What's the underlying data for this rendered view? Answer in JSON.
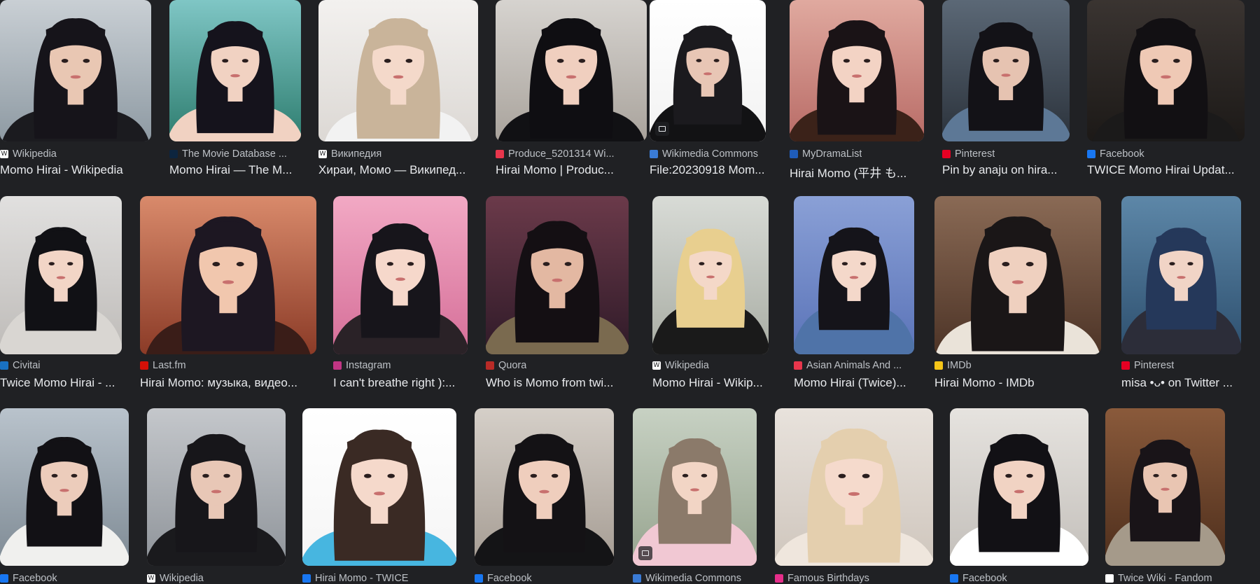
{
  "rows": [
    {
      "items": [
        {
          "source": "Wikipedia",
          "title": "Momo Hirai - Wikipedia",
          "favicon": "W",
          "favicon_color": "#ffffff",
          "favicon_text": "#202124",
          "bg": [
            "#c9cfd4",
            "#8e9aa3"
          ],
          "hair": "#16141a",
          "skin": "#e9c7b3",
          "outfit": "#1b1b1f",
          "icon": "wikipedia-icon"
        },
        {
          "source": "The Movie Database ...",
          "title": "Momo Hirai — The M...",
          "favicon": "",
          "favicon_color": "#0d253f",
          "favicon_text": "#90cea1",
          "bg": [
            "#7fc6c5",
            "#2e7d6f"
          ],
          "hair": "#15131c",
          "skin": "#f1d2c2",
          "outfit": "#f1d2c2",
          "icon": "tmdb-icon"
        },
        {
          "source": "Википедия",
          "title": "Хираи, Момо — Википед...",
          "favicon": "W",
          "favicon_color": "#ffffff",
          "favicon_text": "#202124",
          "bg": [
            "#f3f1ef",
            "#dcd8d4"
          ],
          "hair": "#c9b49a",
          "skin": "#f4d9ca",
          "outfit": "#f2f2f2",
          "icon": "wikipedia-icon"
        },
        {
          "source": "Produce_5201314 Wi...",
          "title": "Hirai Momo | Produc...",
          "favicon": "",
          "favicon_color": "#e8364c",
          "favicon_text": "#ffffff",
          "bg": [
            "#d6d3cf",
            "#a9a39c"
          ],
          "hair": "#0f0e12",
          "skin": "#f0cfbf",
          "outfit": "#111114",
          "icon": "fandom-icon"
        },
        {
          "source": "Wikimedia Commons",
          "title": "File:20230918 Mom...",
          "favicon": "",
          "favicon_color": "#3a7bd5",
          "favicon_text": "#ffffff",
          "bg": [
            "#ffffff",
            "#f2f2f2"
          ],
          "hair": "#1b1a1e",
          "skin": "#e8c6b5",
          "outfit": "#121214",
          "icon": "wikimedia-icon",
          "badge": true
        },
        {
          "source": "MyDramaList",
          "title": "Hirai Momo (平井 も...",
          "favicon": "",
          "favicon_color": "#1f5cb8",
          "favicon_text": "#ffffff",
          "bg": [
            "#e0a99f",
            "#b86b66"
          ],
          "hair": "#1a1316",
          "skin": "#f3d3c4",
          "outfit": "#3b2219",
          "icon": "mydramalist-icon"
        },
        {
          "source": "Pinterest",
          "title": "Pin by anaju on hira...",
          "favicon": "",
          "favicon_color": "#e60023",
          "favicon_text": "#ffffff",
          "bg": [
            "#5b6876",
            "#2b323b"
          ],
          "hair": "#131217",
          "skin": "#e6c3b1",
          "outfit": "#5d7896",
          "icon": "pinterest-icon"
        },
        {
          "source": "Facebook",
          "title": "TWICE Momo Hirai Updat...",
          "favicon": "",
          "favicon_color": "#1877f2",
          "favicon_text": "#ffffff",
          "bg": [
            "#3a3431",
            "#1c1917"
          ],
          "hair": "#121013",
          "skin": "#efc9b5",
          "outfit": "#1b1a1a",
          "icon": "facebook-icon"
        }
      ]
    },
    {
      "items": [
        {
          "source": "Civitai",
          "title": "Twice Momo Hirai - ...",
          "favicon": "",
          "favicon_color": "#1971c2",
          "favicon_text": "#ffffff",
          "bg": [
            "#e1e0df",
            "#bebbb8"
          ],
          "hair": "#111115",
          "skin": "#f2d5c6",
          "outfit": "#d9d6d2",
          "icon": "civitai-icon"
        },
        {
          "source": "Last.fm",
          "title": "Hirai Momo: музыка, видео...",
          "favicon": "",
          "favicon_color": "#d51007",
          "favicon_text": "#ffffff",
          "bg": [
            "#d98a6b",
            "#8b3b27"
          ],
          "hair": "#1d1722",
          "skin": "#f1c7ae",
          "outfit": "#3a1d18",
          "icon": "lastfm-icon"
        },
        {
          "source": "Instagram",
          "title": "I can't breathe right ):...",
          "favicon": "",
          "favicon_color": "#c13584",
          "favicon_text": "#ffffff",
          "bg": [
            "#f2a9c4",
            "#d56e98"
          ],
          "hair": "#17151b",
          "skin": "#f6d8cb",
          "outfit": "#2a2227",
          "icon": "instagram-icon"
        },
        {
          "source": "Quora",
          "title": "Who is Momo from twi...",
          "favicon": "",
          "favicon_color": "#b92b27",
          "favicon_text": "#ffffff",
          "bg": [
            "#6b3a4a",
            "#2f1a28"
          ],
          "hair": "#140f13",
          "skin": "#e3b8a2",
          "outfit": "#7a6a4f",
          "icon": "quora-icon"
        },
        {
          "source": "Wikipedia",
          "title": "Momo Hirai - Wikip...",
          "favicon": "W",
          "favicon_color": "#ffffff",
          "favicon_text": "#202124",
          "bg": [
            "#d8dbd6",
            "#a9ada4"
          ],
          "hair": "#e8cf8f",
          "skin": "#f4d8c8",
          "outfit": "#1a1a1a",
          "icon": "wikipedia-icon"
        },
        {
          "source": "Asian Animals And ...",
          "title": "Momo Hirai (Twice)...",
          "favicon": "",
          "favicon_color": "#e8364c",
          "favicon_text": "#ffffff",
          "bg": [
            "#8aa0d6",
            "#5a73b8"
          ],
          "hair": "#15141a",
          "skin": "#f4d8ca",
          "outfit": "#4f73a8",
          "icon": "fandom-icon"
        },
        {
          "source": "IMDb",
          "title": "Hirai Momo - IMDb",
          "favicon": "",
          "favicon_color": "#f5c518",
          "favicon_text": "#000000",
          "bg": [
            "#8a6a55",
            "#4d3427"
          ],
          "hair": "#1a1617",
          "skin": "#efd0bf",
          "outfit": "#eae3d9",
          "icon": "imdb-icon"
        },
        {
          "source": "Pinterest",
          "title": "misa •ᴗ• on Twitter ...",
          "favicon": "",
          "favicon_color": "#e60023",
          "favicon_text": "#ffffff",
          "bg": [
            "#5d87a8",
            "#2d4f6e"
          ],
          "hair": "#25385a",
          "skin": "#f1d4c6",
          "outfit": "#2c2d39",
          "icon": "pinterest-icon"
        }
      ]
    },
    {
      "items": [
        {
          "source": "Facebook",
          "title": "",
          "favicon": "",
          "favicon_color": "#1877f2",
          "favicon_text": "#ffffff",
          "bg": [
            "#b9c3cc",
            "#7e8a94"
          ],
          "hair": "#121115",
          "skin": "#ecccbb",
          "outfit": "#f0f0ee",
          "icon": "facebook-icon"
        },
        {
          "source": "Wikipedia",
          "title": "",
          "favicon": "W",
          "favicon_color": "#ffffff",
          "favicon_text": "#202124",
          "bg": [
            "#c4c7cb",
            "#8f949a"
          ],
          "hair": "#17161a",
          "skin": "#e8c7b6",
          "outfit": "#1a1a1d",
          "icon": "wikipedia-icon"
        },
        {
          "source": "Hirai Momo - TWICE",
          "title": "",
          "favicon": "",
          "favicon_color": "#1877f2",
          "favicon_text": "#ffffff",
          "bg": [
            "#ffffff",
            "#f5f5f5"
          ],
          "hair": "#3a2a24",
          "skin": "#f5d9cb",
          "outfit": "#47b6e0",
          "icon": "facebook-icon"
        },
        {
          "source": "Facebook",
          "title": "",
          "favicon": "",
          "favicon_color": "#1877f2",
          "favicon_text": "#ffffff",
          "bg": [
            "#d5cfc8",
            "#a59c93"
          ],
          "hair": "#141215",
          "skin": "#efcebd",
          "outfit": "#141416",
          "icon": "facebook-icon"
        },
        {
          "source": "Wikimedia Commons",
          "title": "",
          "favicon": "",
          "favicon_color": "#3a7bd5",
          "favicon_text": "#ffffff",
          "bg": [
            "#c7d1c3",
            "#97a48f"
          ],
          "hair": "#8b7a6a",
          "skin": "#f2d5c5",
          "outfit": "#f1c8d3",
          "icon": "wikimedia-icon",
          "badge": true
        },
        {
          "source": "Famous Birthdays",
          "title": "",
          "favicon": "",
          "favicon_color": "#e62e8a",
          "favicon_text": "#ffffff",
          "bg": [
            "#e8e2dc",
            "#cfc6bd"
          ],
          "hair": "#e4cfae",
          "skin": "#f5dacc",
          "outfit": "#efe6dd",
          "icon": "famous-birthdays-icon"
        },
        {
          "source": "Facebook",
          "title": "",
          "favicon": "",
          "favicon_color": "#1877f2",
          "favicon_text": "#ffffff",
          "bg": [
            "#e6e3df",
            "#c3bfba"
          ],
          "hair": "#121115",
          "skin": "#f1d3c3",
          "outfit": "#ffffff",
          "icon": "facebook-icon"
        },
        {
          "source": "Twice Wiki - Fandom",
          "title": "",
          "favicon": "",
          "favicon_color": "#ffffff",
          "favicon_text": "#202124",
          "bg": [
            "#8a5a3b",
            "#4d2e1c"
          ],
          "hair": "#191418",
          "skin": "#e9c5b2",
          "outfit": "#a59a8a",
          "icon": "fandom-icon"
        }
      ]
    }
  ]
}
